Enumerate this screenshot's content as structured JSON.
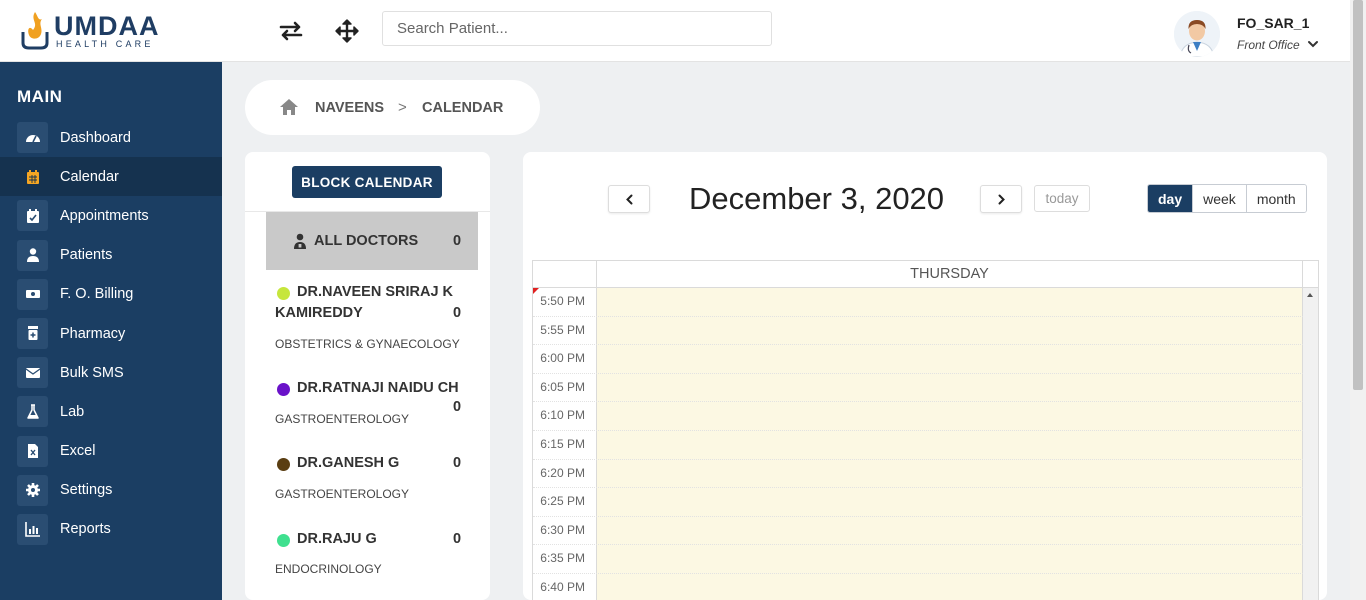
{
  "header": {
    "logo": {
      "name": "UMDAA",
      "tagline": "HEALTH CARE"
    },
    "icons": [
      "swap-icon",
      "move-icon"
    ],
    "search": {
      "placeholder": "Search Patient...",
      "value": ""
    },
    "user": {
      "name": "FO_SAR_1",
      "role": "Front Office"
    }
  },
  "sidebar": {
    "title": "MAIN",
    "items": [
      {
        "label": "Dashboard",
        "icon": "dashboard-icon",
        "active": false
      },
      {
        "label": "Calendar",
        "icon": "calendar-icon",
        "active": true
      },
      {
        "label": "Appointments",
        "icon": "appointments-icon",
        "active": false
      },
      {
        "label": "Patients",
        "icon": "patients-icon",
        "active": false
      },
      {
        "label": "F. O. Billing",
        "icon": "billing-icon",
        "active": false
      },
      {
        "label": "Pharmacy",
        "icon": "pharmacy-icon",
        "active": false
      },
      {
        "label": "Bulk SMS",
        "icon": "sms-icon",
        "active": false
      },
      {
        "label": "Lab",
        "icon": "lab-icon",
        "active": false
      },
      {
        "label": "Excel",
        "icon": "excel-icon",
        "active": false
      },
      {
        "label": "Settings",
        "icon": "settings-icon",
        "active": false
      },
      {
        "label": "Reports",
        "icon": "reports-icon",
        "active": false
      }
    ]
  },
  "breadcrumb": {
    "home_icon": "home-icon",
    "items": [
      "NAVEENS",
      "CALENDAR"
    ],
    "separator": ">"
  },
  "doctors_panel": {
    "block_button": "BLOCK CALENDAR",
    "all_doctors": {
      "label": "ALL DOCTORS",
      "count": "0"
    },
    "doctors": [
      {
        "name": "DR.NAVEEN SRIRAJ K KAMIREDDY",
        "specialty": "OBSTETRICS & GYNAECOLOGY",
        "count": "0",
        "color": "#c6e63c"
      },
      {
        "name": "DR.RATNAJI NAIDU CH",
        "specialty": "GASTROENTEROLOGY",
        "count": "0",
        "color": "#6a12c9"
      },
      {
        "name": "DR.GANESH G",
        "specialty": "GASTROENTEROLOGY",
        "count": "0",
        "color": "#5a3e12"
      },
      {
        "name": "DR.RAJU G",
        "specialty": "ENDOCRINOLOGY",
        "count": "0",
        "color": "#3fe08f"
      }
    ]
  },
  "calendar": {
    "title": "December 3, 2020",
    "today_label": "today",
    "views": [
      {
        "label": "day",
        "active": true
      },
      {
        "label": "week",
        "active": false
      },
      {
        "label": "month",
        "active": false
      }
    ],
    "day_label": "THURSDAY",
    "slots": [
      "5:50 PM",
      "5:55 PM",
      "6:00 PM",
      "6:05 PM",
      "6:10 PM",
      "6:15 PM",
      "6:20 PM",
      "6:25 PM",
      "6:30 PM",
      "6:35 PM",
      "6:40 PM"
    ]
  },
  "colors": {
    "navy": "#1b3e63",
    "day_highlight": "#fcf8e3",
    "now_indicator": "#e02020"
  }
}
